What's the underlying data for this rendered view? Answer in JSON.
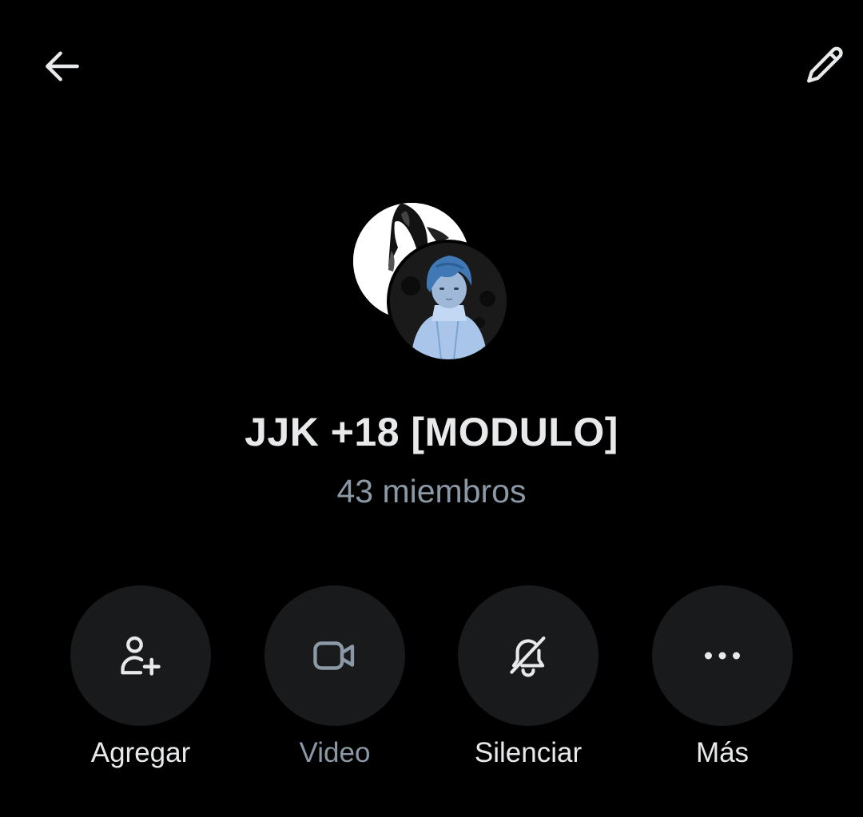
{
  "header": {
    "back_icon": "arrow-left-icon",
    "edit_icon": "pencil-icon"
  },
  "group": {
    "name": "JJK +18 [MODULO]",
    "members": "43 miembros"
  },
  "actions": [
    {
      "label": "Agregar",
      "icon": "person-add-icon",
      "enabled": true
    },
    {
      "label": "Video",
      "icon": "video-camera-icon",
      "enabled": false
    },
    {
      "label": "Silenciar",
      "icon": "bell-off-icon",
      "enabled": true
    },
    {
      "label": "Más",
      "icon": "more-horizontal-icon",
      "enabled": true
    }
  ],
  "colors": {
    "background": "#000000",
    "text_primary": "#e7e9ea",
    "text_secondary": "#8b98a5",
    "action_circle": "#181a1c"
  }
}
